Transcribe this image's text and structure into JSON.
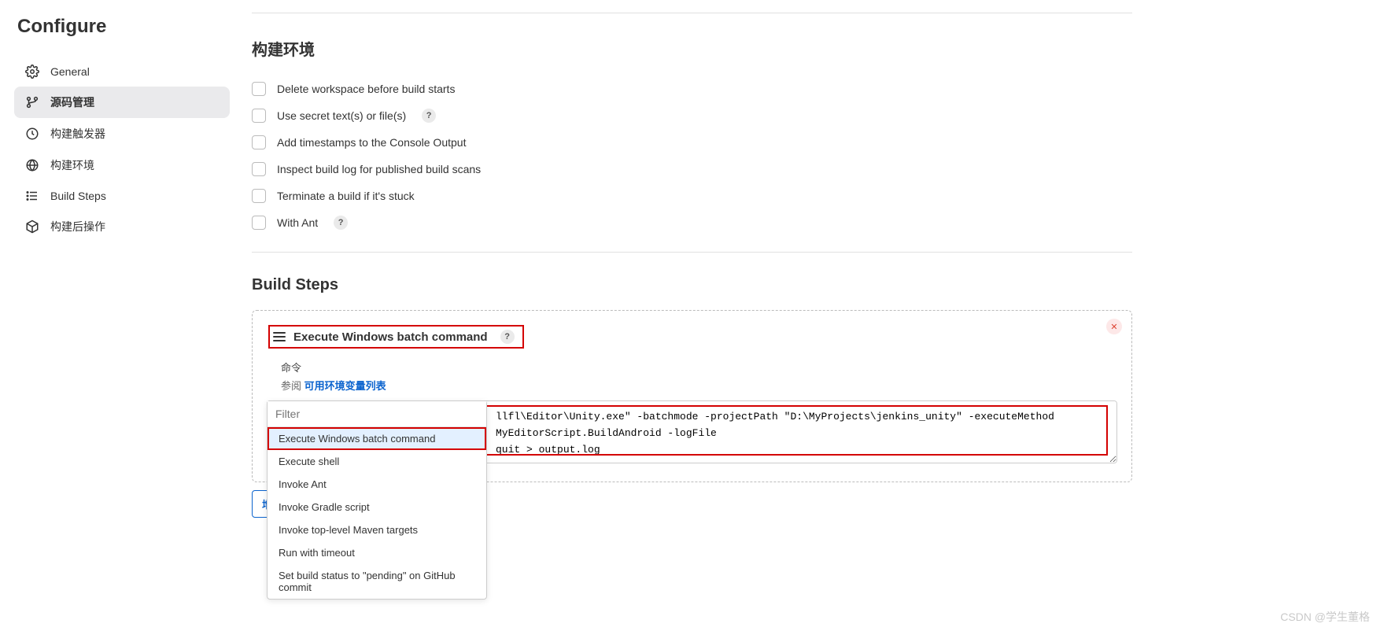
{
  "sidebar": {
    "title": "Configure",
    "items": [
      {
        "label": "General",
        "icon": "gear-icon"
      },
      {
        "label": "源码管理",
        "icon": "branch-icon",
        "active": true
      },
      {
        "label": "构建触发器",
        "icon": "clock-icon"
      },
      {
        "label": "构建环境",
        "icon": "globe-icon"
      },
      {
        "label": "Build Steps",
        "icon": "list-icon"
      },
      {
        "label": "构建后操作",
        "icon": "cube-icon"
      }
    ]
  },
  "env_section": {
    "title": "构建环境",
    "options": [
      {
        "label": "Delete workspace before build starts",
        "help": false
      },
      {
        "label": "Use secret text(s) or file(s)",
        "help": true
      },
      {
        "label": "Add timestamps to the Console Output",
        "help": false
      },
      {
        "label": "Inspect build log for published build scans",
        "help": false
      },
      {
        "label": "Terminate a build if it's stuck",
        "help": false
      },
      {
        "label": "With Ant",
        "help": true
      }
    ]
  },
  "build_steps": {
    "title": "Build Steps",
    "step_title": "Execute Windows batch command",
    "cmd_label": "命令",
    "env_ref_prefix": "参阅 ",
    "env_ref_link": "可用环境变量列表",
    "command_text": "llfl\\Editor\\Unity.exe\" -batchmode -projectPath \"D:\\MyProjects\\jenkins_unity\" -executeMethod MyEditorScript.BuildAndroid -logFile\nquit > output.log",
    "add_button": "增加构建步骤",
    "help_badge": "?"
  },
  "dropdown": {
    "filter_placeholder": "Filter",
    "options": [
      "Execute Windows batch command",
      "Execute shell",
      "Invoke Ant",
      "Invoke Gradle script",
      "Invoke top-level Maven targets",
      "Run with timeout",
      "Set build status to \"pending\" on GitHub commit"
    ],
    "selected_index": 0
  },
  "watermark": "CSDN @学生董格"
}
